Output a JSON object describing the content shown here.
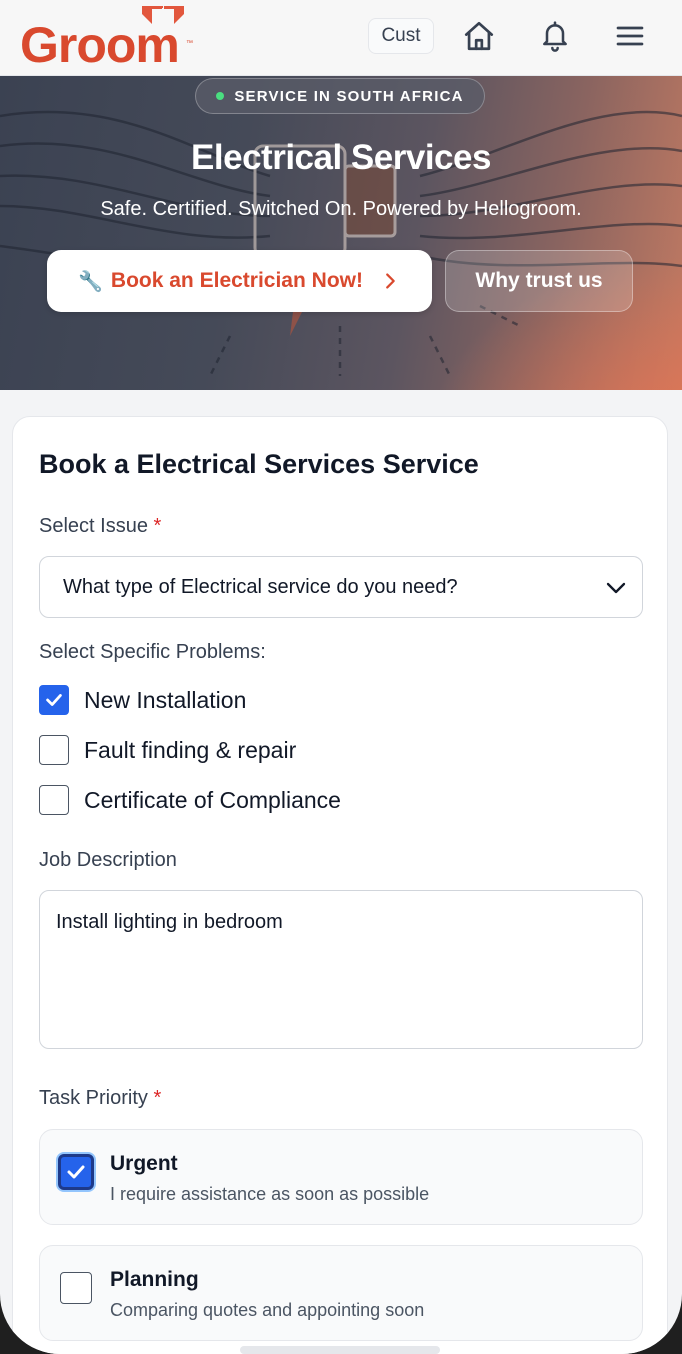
{
  "header": {
    "logo_text": "Groom",
    "logo_tm": "™",
    "cust_label": "Cust",
    "icons": [
      "home-icon",
      "bell-icon",
      "menu-icon"
    ]
  },
  "hero": {
    "badge": "SERVICE IN SOUTH AFRICA",
    "title": "Electrical Services",
    "subtitle": "Safe. Certified. Switched On. Powered by Hellogroom.",
    "book_icon": "🔧",
    "book_label": "Book an Electrician Now!",
    "trust_label": "Why trust us"
  },
  "form": {
    "title": "Book a Electrical Services Service",
    "issue_label": "Select Issue",
    "required_mark": "*",
    "issue_value": "What type of Electrical service do you need?",
    "problems_label": "Select Specific Problems:",
    "problems": [
      {
        "label": "New Installation",
        "checked": true
      },
      {
        "label": "Fault finding & repair",
        "checked": false
      },
      {
        "label": "Certificate of Compliance",
        "checked": false
      }
    ],
    "description_label": "Job Description",
    "description_value": "Install lighting in bedroom",
    "priority_label": "Task Priority",
    "priorities": [
      {
        "title": "Urgent",
        "desc": "I require assistance as soon as possible",
        "checked": true
      },
      {
        "title": "Planning",
        "desc": "Comparing quotes and appointing soon",
        "checked": false
      }
    ]
  },
  "colors": {
    "brand": "#d9492e",
    "accent": "#2563eb",
    "required": "#dc2626"
  }
}
